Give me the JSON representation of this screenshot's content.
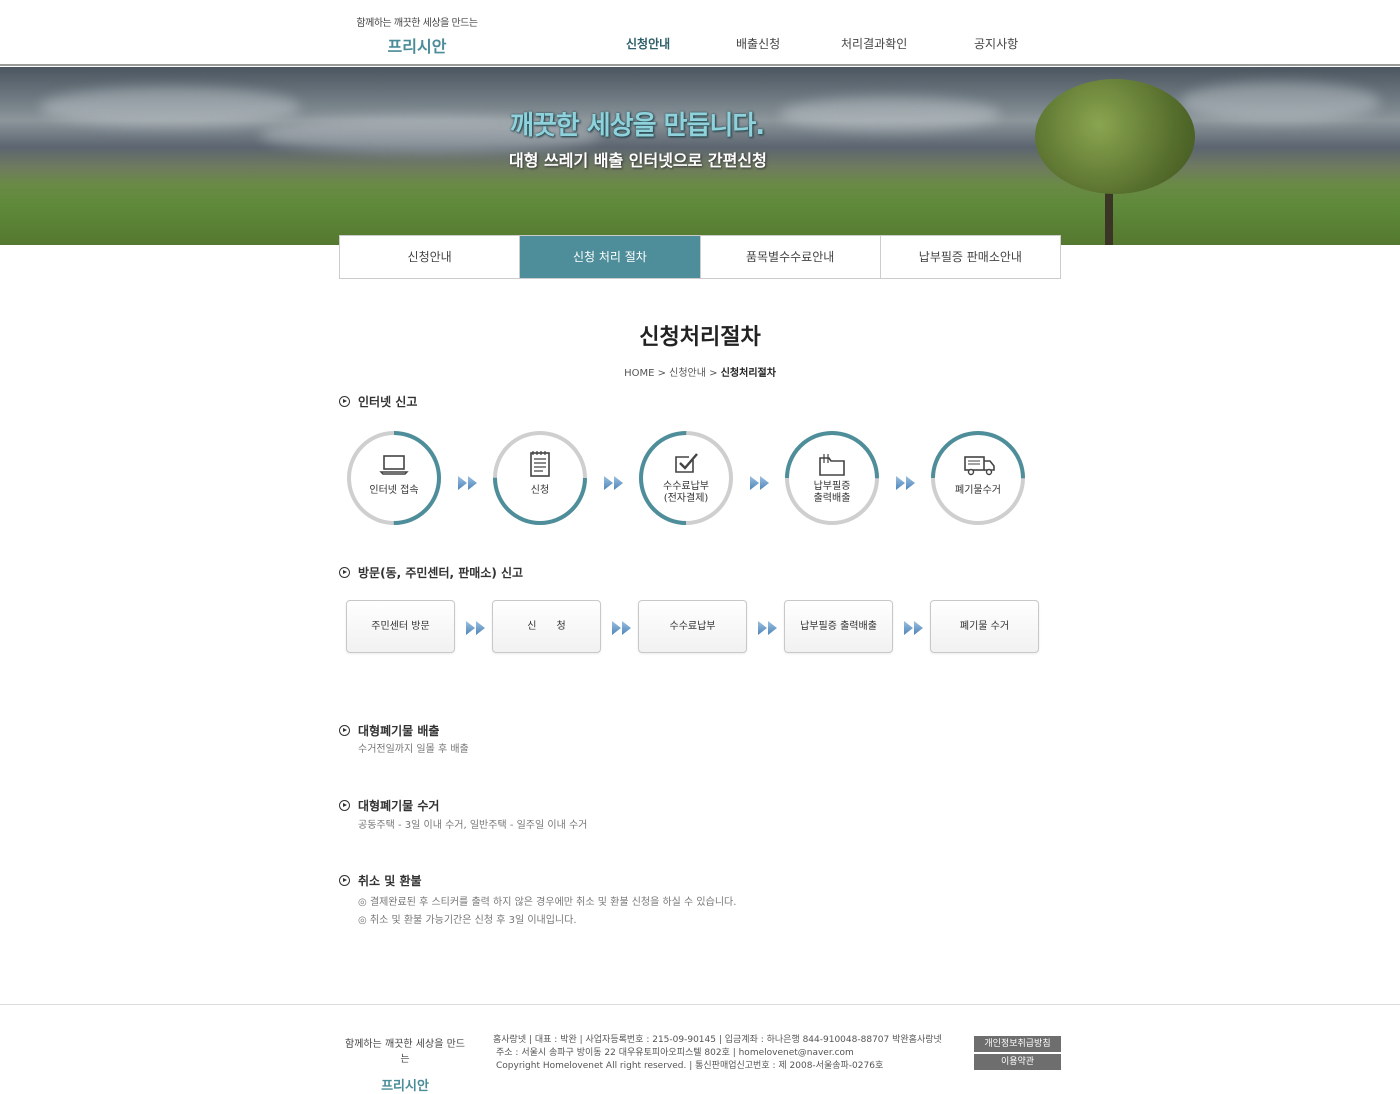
{
  "header": {
    "logo_tagline": "함께하는 깨끗한 세상을 만드는",
    "logo_name": "프리시안",
    "nav": [
      "신청안내",
      "배출신청",
      "처리결과확인",
      "공지사항"
    ],
    "active_nav": "신청안내"
  },
  "banner": {
    "title": "깨끗한 세상을 만듭니다.",
    "subtitle": "대형 쓰레기 배출 인터넷으로 간편신청"
  },
  "tabs": [
    "신청안내",
    "신청 처리 절차",
    "품목별수수료안내",
    "납부필증 판매소안내"
  ],
  "active_tab": "신청 처리 절차",
  "page": {
    "title": "신청처리절차",
    "breadcrumb": {
      "home": "HOME",
      "parent": "신청안내",
      "current": "신청처리절차"
    }
  },
  "internet_section": {
    "heading": "인터넷 신고",
    "steps": [
      {
        "label": "인터넷 접속",
        "icon": "laptop-icon",
        "progress": 0.5
      },
      {
        "label": "신청",
        "icon": "document-icon",
        "progress": 0.5
      },
      {
        "label": "수수료납부\n(전자결제)",
        "icon": "check-icon",
        "progress": 0.5
      },
      {
        "label": "납부필증\n출력배출",
        "icon": "folder-icon",
        "progress": 0.5
      },
      {
        "label": "폐기물수거",
        "icon": "truck-icon",
        "progress": 0.5
      }
    ]
  },
  "visit_section": {
    "heading": "방문(동, 주민센터, 판매소) 신고",
    "steps": [
      "주민센터 방문",
      "신　　청",
      "수수료납부",
      "납부필증 출력배출",
      "폐기물 수거"
    ]
  },
  "info_sections": [
    {
      "heading": "대형폐기물 배출",
      "lines": [
        "수거전일까지 일몰 후 배출"
      ]
    },
    {
      "heading": "대형폐기물 수거",
      "lines": [
        "공동주택 - 3일 이내 수거, 일반주택 - 일주일 이내 수거"
      ]
    },
    {
      "heading": "취소 및 환불",
      "lines": [
        "◎ 결제완료된 후 스티커를 출력 하지 않은 경우에만 취소 및 환불 신청을 하실 수 있습니다.",
        "◎ 취소 및 환불 가능기간은 신청 후 3일 이내입니다."
      ]
    }
  ],
  "footer": {
    "tagline": "함께하는 깨끗한 세상을 만드는",
    "name": "프리시안",
    "info_lines": [
      "홈사랑넷  |  대표 : 박완  |  사업자등록번호 : 215-09-90145  |  입금계좌 : 하나은행 844-910048-88707 박완홈사랑넷",
      "주소 : 서울시 송파구 방이동 22 대우유토피아오피스텔 802호  |  homelovenet@naver.com",
      "Copyright Homelovenet All right reserved.  |  통신판매업신고번호 : 제 2008-서울송파-0276호"
    ],
    "links": [
      "개인정보취급방침",
      "이용약관"
    ]
  },
  "colors": {
    "accent": "#4e8e9a",
    "ring_gray": "#cfcfcf",
    "arrow": "#6b9bc7"
  }
}
